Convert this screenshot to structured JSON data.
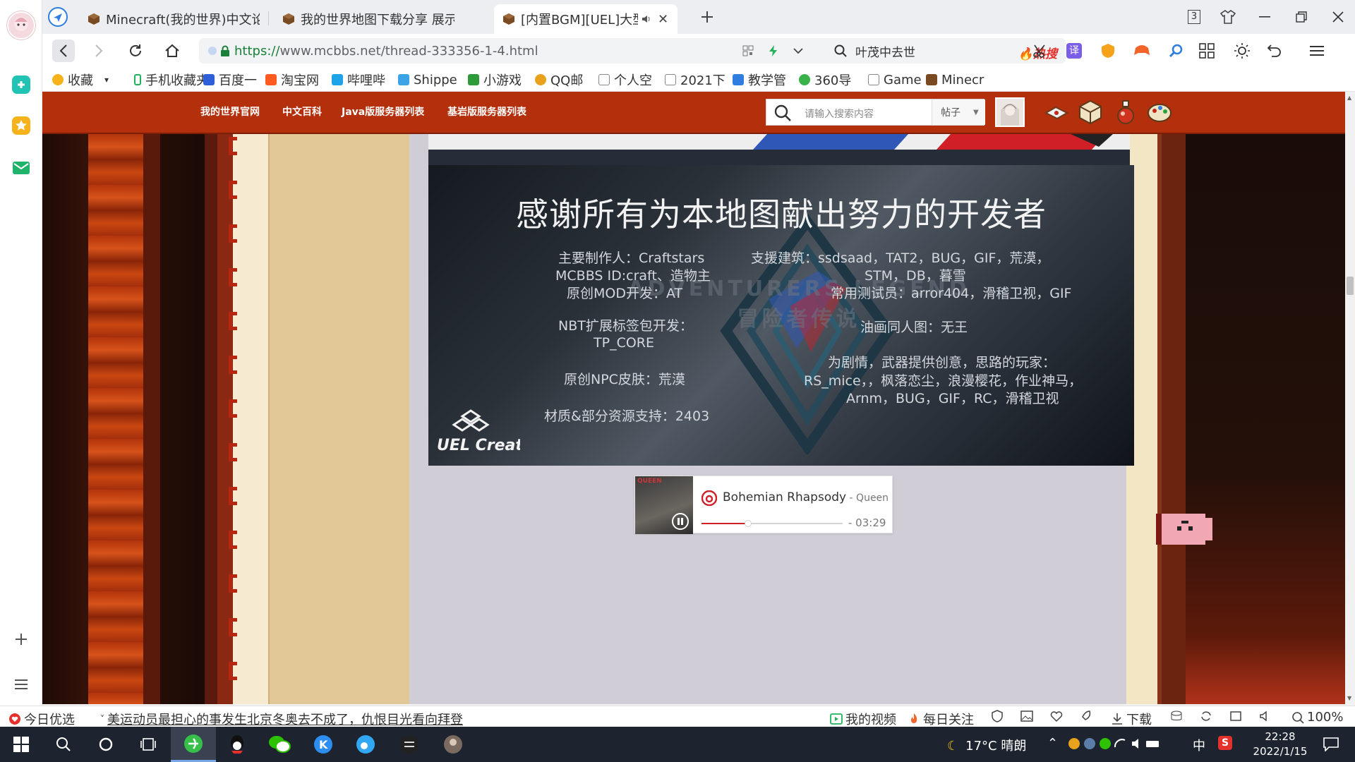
{
  "tabs": [
    {
      "label": "Minecraft(我的世界)中文论"
    },
    {
      "label": "我的世界地图下载分享 展示"
    },
    {
      "label": "[内置BGM][UEL]大型冒"
    }
  ],
  "tab_counter": "3",
  "address": {
    "scheme": "https://",
    "host_path": "www.mcbbs.net/thread-333356-1-4.html"
  },
  "search": {
    "value": "叶茂中去世",
    "hot_label": "热搜"
  },
  "bookmarks": [
    {
      "label": "收藏"
    },
    {
      "label": "手机收藏夹"
    },
    {
      "label": "百度一"
    },
    {
      "label": "淘宝网"
    },
    {
      "label": "哔哩哔"
    },
    {
      "label": "Shippe"
    },
    {
      "label": "小游戏"
    },
    {
      "label": "QQ邮"
    },
    {
      "label": "个人空"
    },
    {
      "label": "2021下"
    },
    {
      "label": "教学管"
    },
    {
      "label": "360导"
    },
    {
      "label": "Game"
    },
    {
      "label": "Minecr"
    }
  ],
  "site": {
    "nav": [
      "我的世界官网",
      "中文百科",
      "Java版服务器列表",
      "基岩版服务器列表"
    ],
    "search_placeholder": "请输入搜索内容",
    "search_scope": "帖子"
  },
  "banner": {
    "title": "感谢所有为本地图献出努力的开发者",
    "credits": [
      "主要制作人：Craftstars",
      "MCBBS ID:craft、造物主",
      "支援建筑：ssdsaad，TAT2，BUG，GIF，荒漠，",
      "STM，DB，暮雪",
      "原创MOD开发：AT",
      "常用测试员：arror404，滑稽卫视，GIF",
      "NBT扩展标签包开发：",
      "TP_CORE",
      "油画同人图：无王",
      "为剧情，武器提供创意，思路的玩家：",
      "原创NPC皮肤：荒漠",
      "RS_mice，，枫落恋尘，浪漫樱花，作业神马，",
      "Arnm，BUG，GIF，RC，滑稽卫视",
      "材质&部分资源支持：2403"
    ],
    "watermark": "ADVENTURERS LEGEND 冒险者传说",
    "logo_text": "UEL Creators"
  },
  "player": {
    "song": "Bohemian Rhapsody",
    "artist": " - Queen",
    "time": "- 03:29",
    "progress_fraction": 0.33,
    "cover_text": "QUEEN"
  },
  "statusbar": {
    "left": "今日优选",
    "news": "美运动员最担心的事发生北京冬奥去不成了，仇恨目光看向拜登",
    "my_video": "我的视频",
    "daily": "每日关注",
    "download": "下载",
    "zoom": "100%"
  },
  "taskbar": {
    "weather": "17°C  晴朗",
    "ime": "中",
    "time": "22:28",
    "date": "2022/1/15"
  },
  "colors": {
    "site_header": "#b42f0c",
    "content_bg": "#d0cdd6",
    "accent_red": "#d11f28",
    "taskbar": "#1d2430"
  }
}
